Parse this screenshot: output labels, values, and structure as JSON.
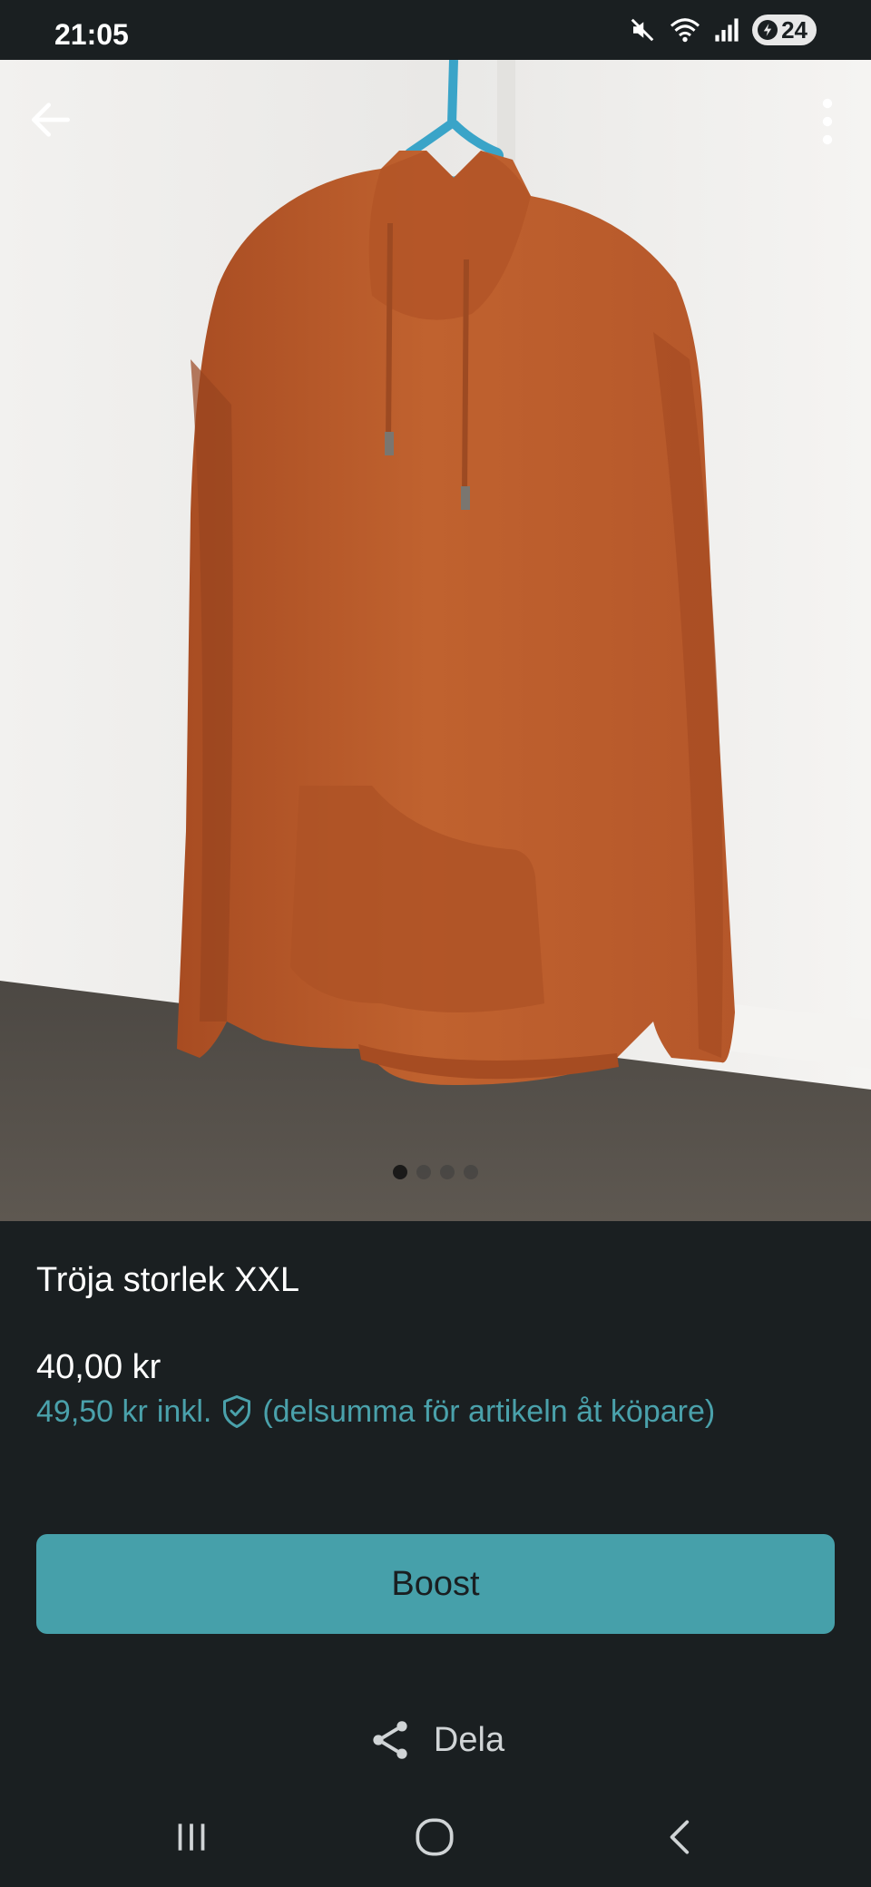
{
  "status_bar": {
    "time": "21:05",
    "battery": "24",
    "icons": [
      "mute-icon",
      "wifi-icon",
      "signal-icon",
      "battery-icon"
    ]
  },
  "photo": {
    "description_icon": "product-photo",
    "page_count": 4,
    "active_index": 0,
    "colors": {
      "garment": "#b8572a",
      "wall": "#efeeec",
      "floor": "#55504a"
    }
  },
  "listing": {
    "title": "Tröja storlek XXL",
    "price": "40,00 kr",
    "buyer_price": "49,50 kr",
    "buyer_price_suffix": "inkl.",
    "buyer_price_note": "(delsumma för artikeln åt köpare)"
  },
  "actions": {
    "boost_label": "Boost",
    "share_label": "Dela"
  },
  "colors": {
    "background": "#1a1f21",
    "accent": "#46a0aa",
    "accent_text": "#4aa1ab"
  }
}
